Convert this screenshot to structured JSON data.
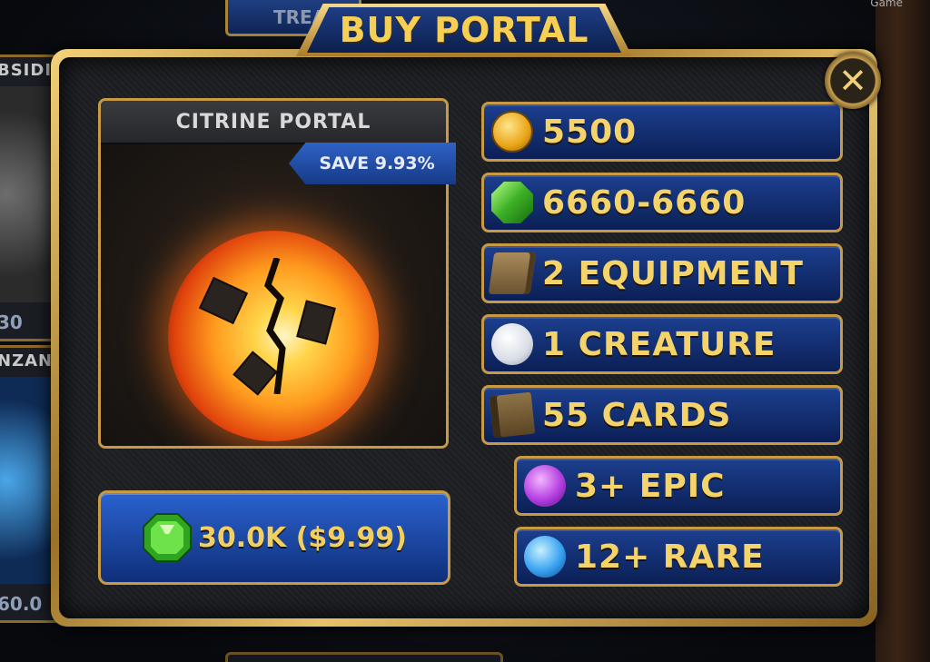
{
  "background": {
    "tab_label": "TREA",
    "cards": [
      {
        "name": "BSIDI",
        "price": "30"
      },
      {
        "name": "NZAN",
        "price": "60.0"
      }
    ],
    "watermark": "Game"
  },
  "modal": {
    "title": "BUY PORTAL",
    "close_icon": "close-icon"
  },
  "portal": {
    "name": "CITRINE PORTAL",
    "save_tag": "SAVE 9.93%",
    "art_icon": "citrine-orb-icon"
  },
  "buy_button": {
    "label": "30.0K ($9.99)",
    "icon": "green-gem-icon"
  },
  "rewards": [
    {
      "icon": "gold-coin-icon",
      "label": "5500"
    },
    {
      "icon": "green-gem-icon",
      "label": "6660-6660"
    },
    {
      "icon": "equipment-box-icon",
      "label": "2 EQUIPMENT"
    },
    {
      "icon": "white-orb-icon",
      "label": "1 CREATURE"
    },
    {
      "icon": "card-book-icon",
      "label": "55 CARDS"
    },
    {
      "icon": "purple-gem-icon",
      "label": "3+ EPIC"
    },
    {
      "icon": "blue-gem-icon",
      "label": "12+ RARE"
    }
  ],
  "colors": {
    "gold_text": "#f4d36a",
    "row_blue": "#1c3f8f",
    "frame_gold": "#c89a45"
  }
}
